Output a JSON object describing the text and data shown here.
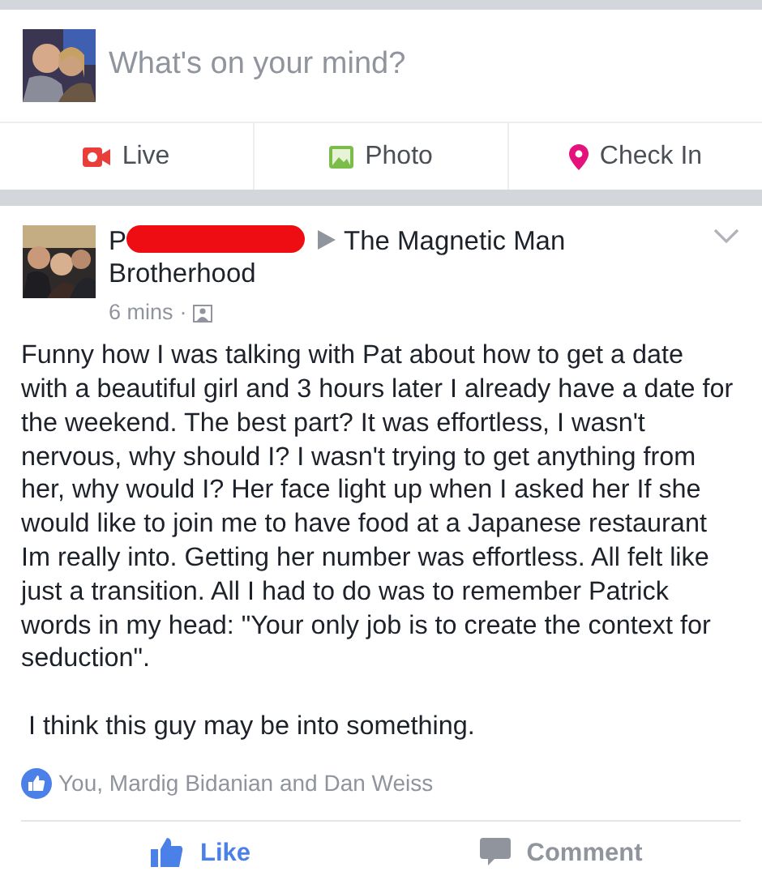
{
  "composer": {
    "placeholder": "What's on your mind?"
  },
  "composer_actions": [
    {
      "kind": "live",
      "label": "Live"
    },
    {
      "kind": "photo",
      "label": "Photo"
    },
    {
      "kind": "checkin",
      "label": "Check In"
    }
  ],
  "post": {
    "author": "P",
    "author_redacted": true,
    "group_lines": [
      "The Magnetic Man",
      "Brotherhood"
    ],
    "time": "6 mins",
    "separator": "·",
    "paragraphs": [
      "Funny how I was talking with Pat about how to get a date with a beautiful girl and 3 hours later I already have a date for the weekend. The best part? It was effortless, I wasn't nervous, why should I? I wasn't trying to get anything from her, why would I? Her face light up when I asked her If she would like to join me to have food at a Japanese restaurant Im really into. Getting her number was effortless. All felt like just a transition. All I had to do was to remember Patrick words in my head: \"Your only job is to create the context for seduction\".",
      " I think this guy may be into something."
    ],
    "likes": "You, Mardig Bidanian and Dan Weiss",
    "actions": [
      {
        "kind": "like",
        "label": "Like",
        "selected": true
      },
      {
        "kind": "comment",
        "label": "Comment",
        "selected": false
      }
    ]
  }
}
